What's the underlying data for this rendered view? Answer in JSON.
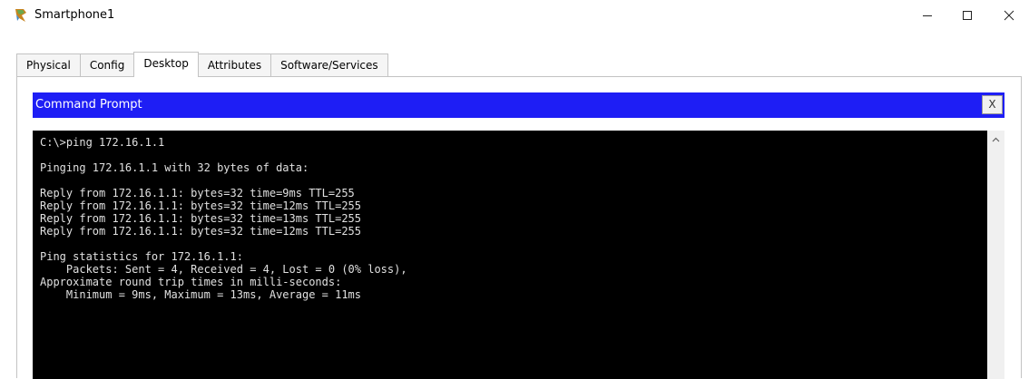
{
  "window": {
    "title": "Smartphone1",
    "icon": "packet-tracer-device-icon",
    "controls": {
      "minimize": "minimize-icon",
      "maximize": "maximize-icon",
      "close": "close-icon"
    }
  },
  "tabs": [
    {
      "label": "Physical",
      "active": false
    },
    {
      "label": "Config",
      "active": false
    },
    {
      "label": "Desktop",
      "active": true
    },
    {
      "label": "Attributes",
      "active": false
    },
    {
      "label": "Software/Services",
      "active": false
    }
  ],
  "command_prompt": {
    "title": "Command Prompt",
    "close_label": "X",
    "header_color": "#1e1ef5",
    "lines": [
      "C:\\>ping 172.16.1.1",
      "",
      "Pinging 172.16.1.1 with 32 bytes of data:",
      "",
      "Reply from 172.16.1.1: bytes=32 time=9ms TTL=255",
      "Reply from 172.16.1.1: bytes=32 time=12ms TTL=255",
      "Reply from 172.16.1.1: bytes=32 time=13ms TTL=255",
      "Reply from 172.16.1.1: bytes=32 time=12ms TTL=255",
      "",
      "Ping statistics for 172.16.1.1:",
      "    Packets: Sent = 4, Received = 4, Lost = 0 (0% loss),",
      "Approximate round trip times in milli-seconds:",
      "    Minimum = 9ms, Maximum = 13ms, Average = 11ms"
    ]
  }
}
